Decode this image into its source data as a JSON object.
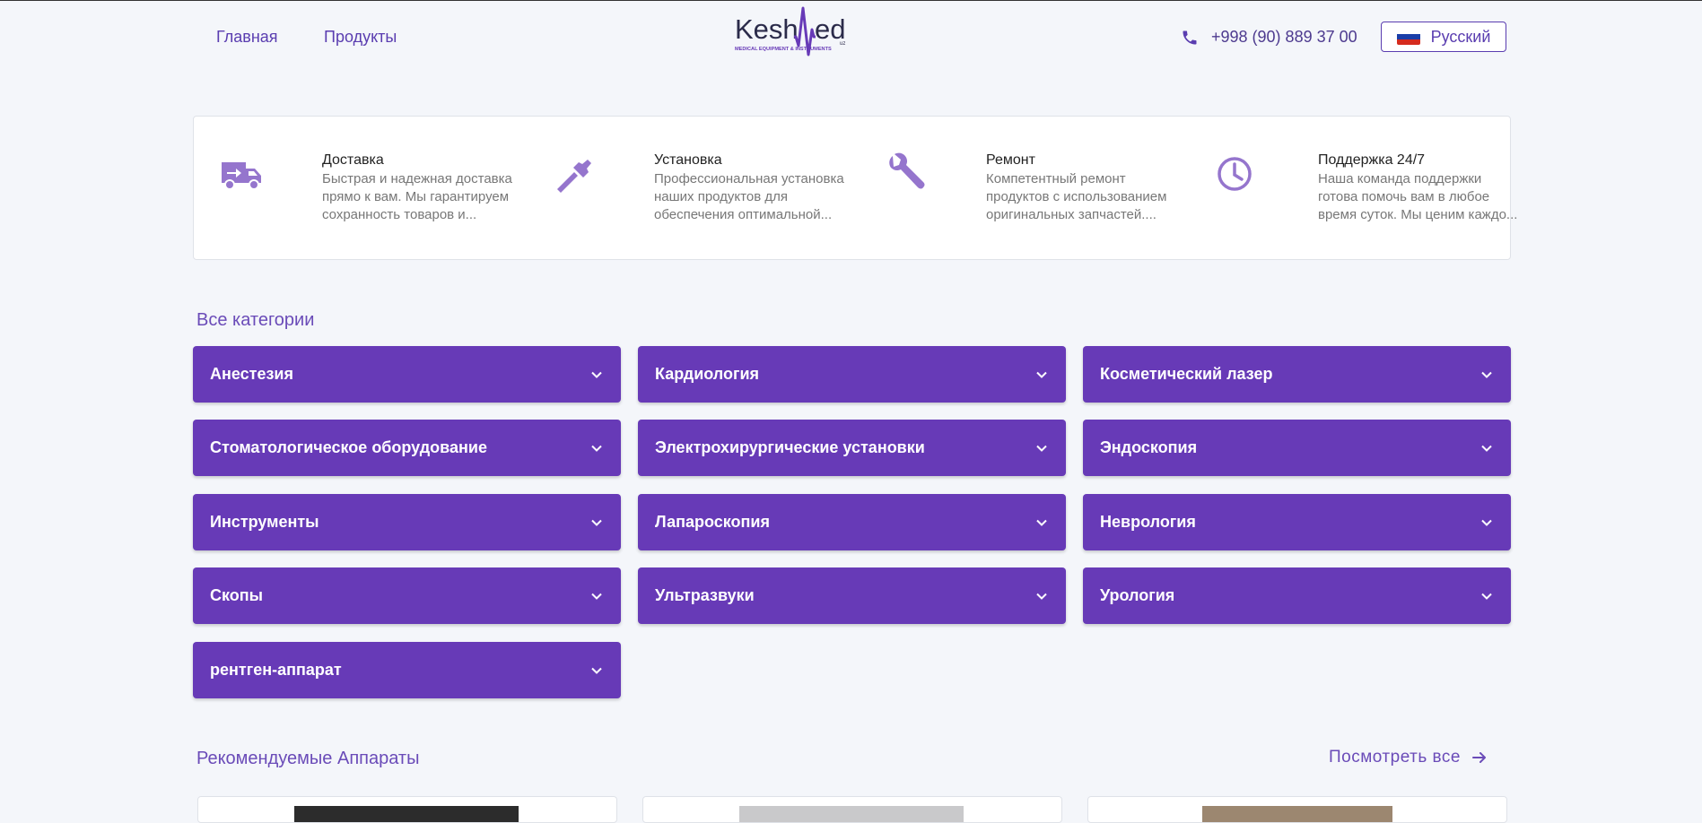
{
  "nav": {
    "home": "Главная",
    "products": "Продукты"
  },
  "logo": {
    "text_part1": "Kesh",
    "text_part2": "ed",
    "suffix": "uz",
    "tagline": "MEDICAL EQUIPMENT & INSTRUMENTS"
  },
  "contact": {
    "phone": "+998 (90) 889 37 00",
    "icon": "phone-icon"
  },
  "language": {
    "selected": "Русский",
    "flag": "russia-flag"
  },
  "features": [
    {
      "icon": "delivery-truck-icon",
      "title": "Доставка",
      "description": "Быстрая и надежная доставка прямо к вам. Мы гарантируем сохранность товаров и..."
    },
    {
      "icon": "hammer-icon",
      "title": "Установка",
      "description": "Профессиональная установка наших продуктов для обеспечения оптимальной..."
    },
    {
      "icon": "wrench-icon",
      "title": "Ремонт",
      "description": "Компетентный ремонт продуктов с использованием оригинальных запчастей...."
    },
    {
      "icon": "clock-icon",
      "title": "Поддержка 24/7",
      "description": "Наша команда поддержки готова помочь вам в любое время суток. Мы ценим каждо..."
    }
  ],
  "categories": {
    "title": "Все категории",
    "items": [
      "Анестезия",
      "Кардиология",
      "Косметический лазер",
      "Стоматологическое оборудование",
      "Электрохирургические установки",
      "Эндоскопия",
      "Инструменты",
      "Лапароскопия",
      "Неврология",
      "Скопы",
      "Ультразвуки",
      "Урология",
      "рентген-аппарат"
    ]
  },
  "featured": {
    "title": "Рекомендуемые Аппараты",
    "view_all": "Посмотреть все"
  },
  "colors": {
    "primary": "#673ab7",
    "accent_text": "#6a4bb8",
    "background": "#f4f6fa",
    "icon": "#9575cd"
  }
}
